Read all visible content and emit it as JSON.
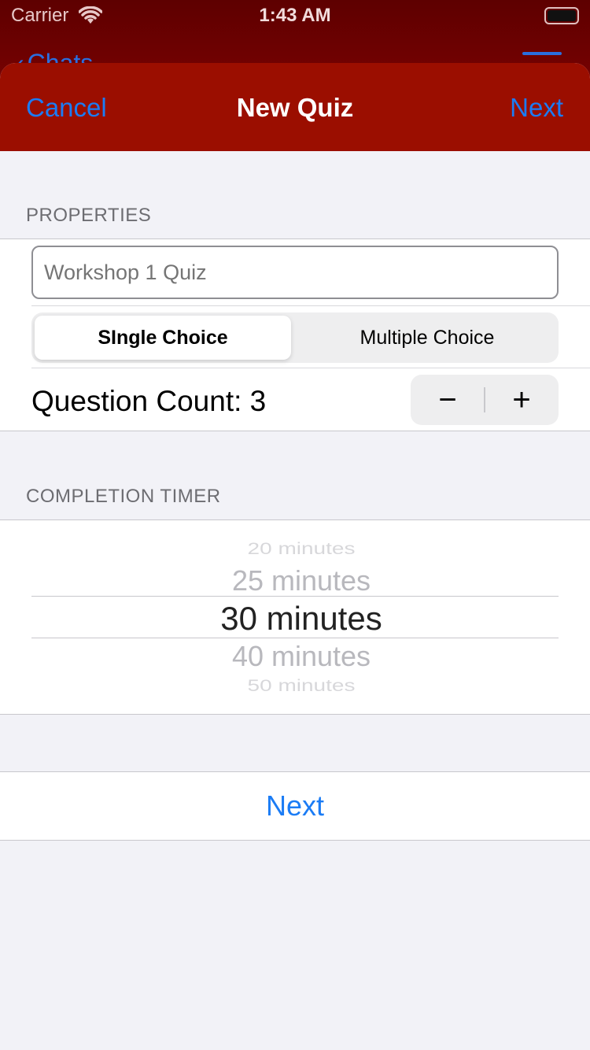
{
  "status_bar": {
    "carrier": "Carrier",
    "time": "1:43 AM"
  },
  "background_nav": {
    "back_label": "Chats"
  },
  "navbar": {
    "cancel_label": "Cancel",
    "title": "New Quiz",
    "next_label": "Next",
    "background_color": "#9b0e00",
    "accent_color": "#1b7cf5"
  },
  "properties": {
    "header": "PROPERTIES",
    "title_field": {
      "value": "",
      "placeholder": "Workshop 1 Quiz"
    },
    "question_type": {
      "options": [
        "SIngle Choice",
        "Multiple Choice"
      ],
      "selected": "SIngle Choice"
    },
    "question_count": {
      "label": "Question Count: 3",
      "value": 3,
      "decrement_symbol": "−",
      "increment_symbol": "+"
    }
  },
  "completion_timer": {
    "header": "COMPLETION TIMER",
    "options": [
      "20 minutes",
      "25 minutes",
      "30 minutes",
      "40 minutes",
      "50 minutes"
    ],
    "selected": "30 minutes"
  },
  "footer": {
    "next_label": "Next"
  }
}
